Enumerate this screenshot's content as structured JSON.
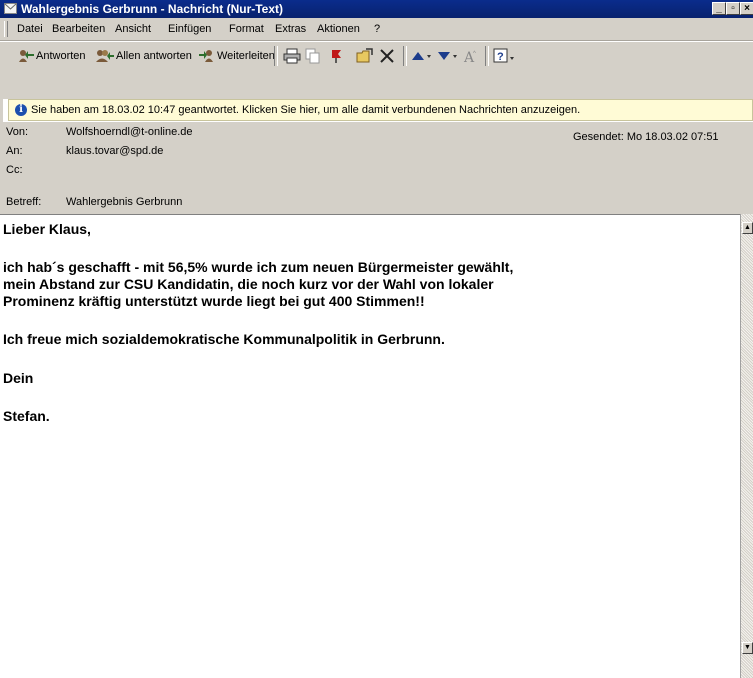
{
  "window": {
    "title": "Wahlergebnis Gerbrunn - Nachricht (Nur-Text)",
    "minimize": "_",
    "maximize": "▫",
    "close": "×"
  },
  "menu": [
    "Datei",
    "Bearbeiten",
    "Ansicht",
    "Einfügen",
    "Format",
    "Extras",
    "Aktionen",
    "?"
  ],
  "toolbar": {
    "reply": "Antworten",
    "reply_all": "Allen antworten",
    "forward": "Weiterleiten"
  },
  "infobar": {
    "text": "Sie haben am 18.03.02 10:47 geantwortet. Klicken Sie hier, um alle damit verbundenen Nachrichten anzuzeigen."
  },
  "header": {
    "from_label": "Von:",
    "from_value": "Wolfshoerndl@t-online.de",
    "to_label": "An:",
    "to_value": "klaus.tovar@spd.de",
    "cc_label": "Cc:",
    "cc_value": "",
    "subject_label": "Betreff:",
    "subject_value": "Wahlergebnis Gerbrunn",
    "sent": "Gesendet: Mo 18.03.02 07:51"
  },
  "message": {
    "greeting": "Lieber Klaus,",
    "p1_l1": "ich hab´s geschafft - mit 56,5% wurde ich zum neuen Bürgermeister gewählt,",
    "p1_l2": "mein Abstand zur CSU Kandidatin, die noch kurz vor der Wahl von lokaler",
    "p1_l3": "Prominenz kräftig unterstützt wurde liegt bei gut 400 Stimmen!!",
    "p2": "Ich freue mich sozialdemokratische Kommunalpolitik in Gerbrunn.",
    "closing": "Dein",
    "signature": "Stefan."
  }
}
